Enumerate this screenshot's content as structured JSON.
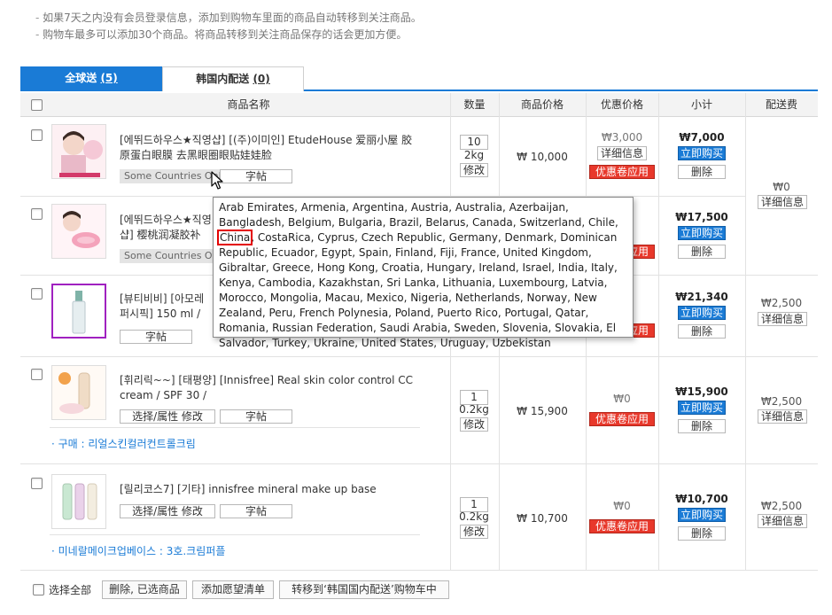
{
  "notes": [
    "如果7天之内没有会员登录信息，添加到购物车里面的商品自动转移到关注商品。",
    "购物车最多可以添加30个商品。将商品转移到关注商品保存的话会更加方便。"
  ],
  "tabs": {
    "global": {
      "label": "全球送",
      "count": "(5)"
    },
    "korea": {
      "label": "韩国内配送",
      "count": "(0)"
    }
  },
  "header": {
    "name": "商品名称",
    "qty": "数量",
    "price": "商品价格",
    "discount": "优惠价格",
    "subtotal": "小计",
    "shipping": "配送费"
  },
  "buttons": {
    "post": "字帖",
    "select_attr": "选择/属性 修改",
    "modify": "修改",
    "coupon": "优惠卷应用",
    "detail": "详细信息",
    "buy_now": "立即购买",
    "delete": "删除"
  },
  "items": [
    {
      "name": "[에뛰드하우스★직영샵] [(주)이미인] EtudeHouse 爱丽小屋 胶原蛋白眼膜 去黑眼圈眼贴娃娃脸",
      "tag": "Some Countries Only",
      "qty": "10",
      "weight": "2kg",
      "price": "₩ 10,000",
      "discount": "₩3,000",
      "subtotal": "₩7,000"
    },
    {
      "name": "[에뛰드하우스★직영샵] 樱桃润凝胶补丁/10g",
      "tag": "Some Countries Only",
      "subtotal": "₩17,500"
    },
    {
      "name": "[뷰티비비] [아모레퍼시픽] 150 ml / hydration /",
      "subtotal": "₩21,340"
    },
    {
      "name": "[휘리릭~~] [태평양] [Innisfree] Real skin color control CC cream / SPF 30 /",
      "qty": "1",
      "weight": "0.2kg",
      "price": "₩ 15,900",
      "discount": "₩0",
      "subtotal": "₩15,900",
      "option": "구매 : 리얼스킨컬러컨트롤크림"
    },
    {
      "name": "[릴리코스7] [기타] innisfree mineral make up base",
      "qty": "1",
      "weight": "0.2kg",
      "price": "₩ 10,700",
      "discount": "₩0",
      "subtotal": "₩10,700",
      "option": "미네랄메이크업베이스 : 3호.크림퍼플"
    }
  ],
  "shipping": {
    "group1": "₩0",
    "row3": "₩2,500",
    "row4": "₩2,500",
    "row5": "₩2,500"
  },
  "tooltip": {
    "before": "Arab Emirates, Armenia, Argentina, Austria, Australia, Azerbaijan, Bangladesh, Belgium, Bulgaria, Brazil, Belarus, Canada, Switzerland, Chile, ",
    "highlight": "China",
    "after": ", CostaRica, Cyprus, Czech Republic, Germany, Denmark, Dominican Republic, Ecuador, Egypt, Spain, Finland, Fiji, France, United Kingdom, Gibraltar, Greece, Hong Kong, Croatia, Hungary, Ireland, Israel, India, Italy, Kenya, Cambodia, Kazakhstan, Sri Lanka, Lithuania, Luxembourg, Latvia, Morocco, Mongolia, Macau, Mexico, Nigeria, Netherlands, Norway, New Zealand, Peru, French Polynesia, Poland, Puerto Rico, Portugal, Qatar, Romania, Russian Federation, Saudi Arabia, Sweden, Slovenia, Slovakia, El Salvador, Turkey, Ukraine, United States, Uruguay, Uzbekistan"
  },
  "bottom": {
    "select_all": "选择全部",
    "delete_selected": "删除, 已选商品",
    "add_wishlist": "添加愿望清单",
    "move_korea": "转移到‘韩国国内配送’购物车中"
  },
  "colors": {
    "accent": "#1a7bd6",
    "coupon": "#e8382b",
    "highlight_border": "#e30000"
  }
}
